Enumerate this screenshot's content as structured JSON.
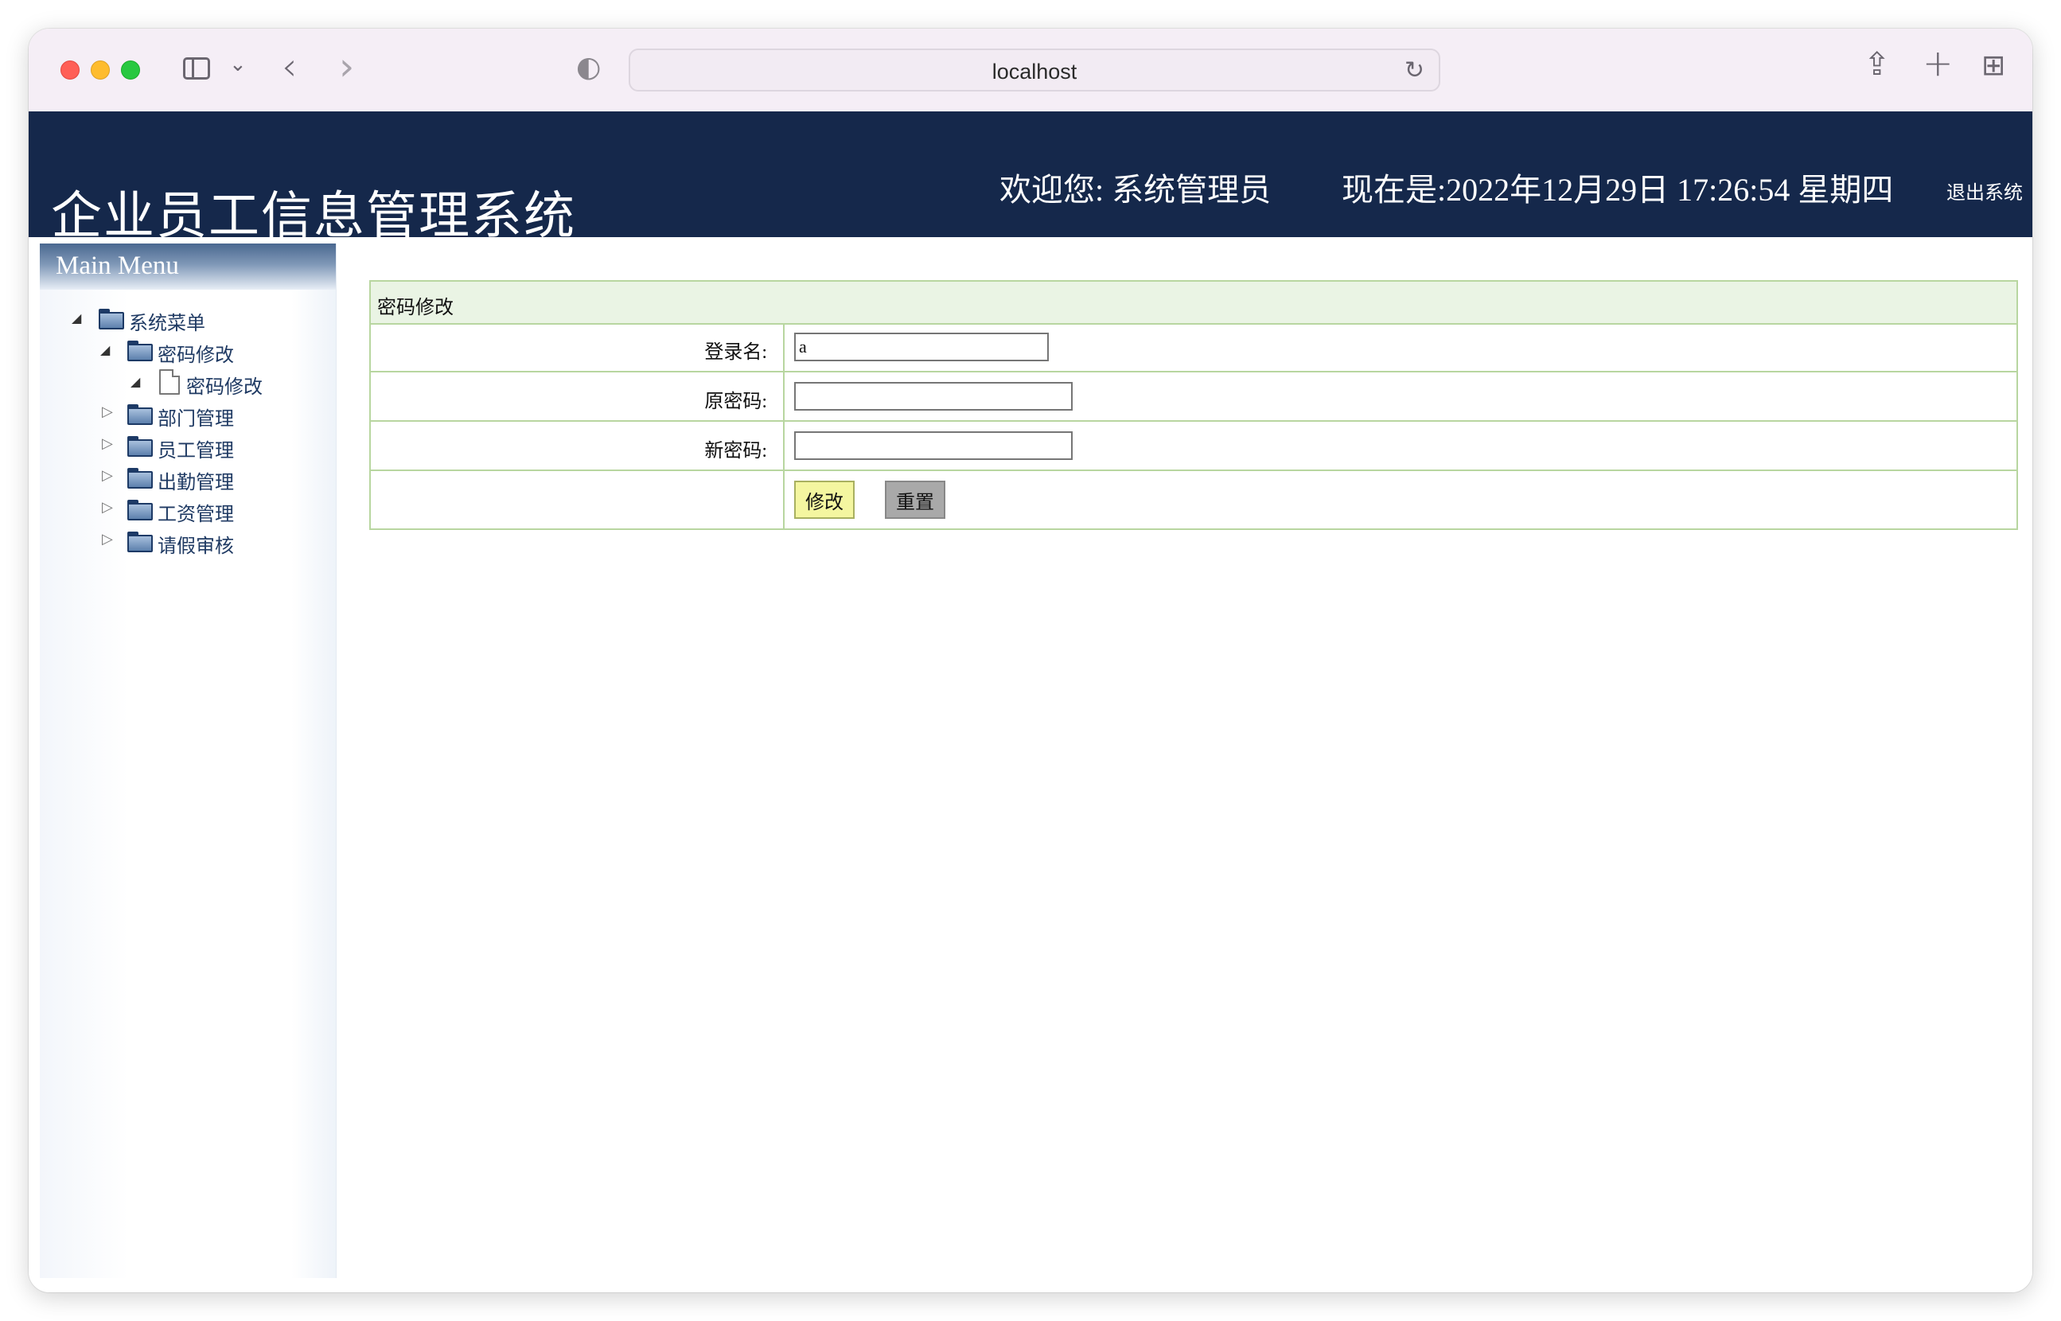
{
  "browser": {
    "url": "localhost",
    "icons": {
      "sidebar": "sidebar-toggle-icon",
      "dropdown": "chevron-down-icon",
      "back": "back-arrow-icon",
      "forward": "forward-arrow-icon",
      "privacy": "shield-icon",
      "reload": "reload-icon",
      "share": "share-icon",
      "new_tab": "plus-icon",
      "tab_overview": "grid-icon"
    }
  },
  "header": {
    "title": "企业员工信息管理系统",
    "welcome": "欢迎您:  系统管理员",
    "clock": "现在是:2022年12月29日 17:26:54 星期四",
    "logout": "退出系统",
    "background": "#15284b"
  },
  "menu": {
    "title": "Main Menu",
    "root": "系统菜单",
    "items": [
      {
        "label": "密码修改",
        "expanded": true,
        "children": [
          {
            "label": "密码修改"
          }
        ]
      },
      {
        "label": "部门管理",
        "expanded": false
      },
      {
        "label": "员工管理",
        "expanded": false
      },
      {
        "label": "出勤管理",
        "expanded": false
      },
      {
        "label": "工资管理",
        "expanded": false
      },
      {
        "label": "请假审核",
        "expanded": false
      }
    ]
  },
  "form": {
    "caption": "密码修改",
    "login_label": "登录名:",
    "login_value": "a",
    "old_password_label": "原密码:",
    "new_password_label": "新密码:",
    "submit_label": "修改",
    "reset_label": "重置",
    "border_color": "#b8d6a0"
  }
}
